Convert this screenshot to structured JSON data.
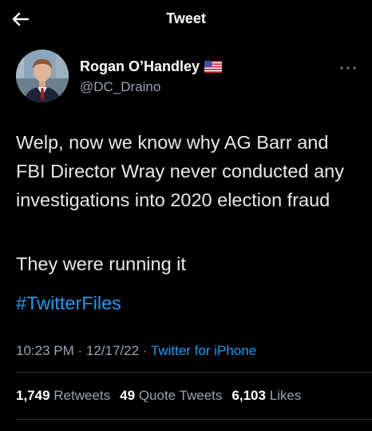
{
  "header": {
    "title": "Tweet",
    "back_icon": "arrow-left-icon"
  },
  "author": {
    "display_name": "Rogan O’Handley",
    "handle": "@DC_Draino",
    "flag_icon": "us-flag-icon",
    "more_icon": "more-horizontal-icon"
  },
  "tweet": {
    "text_line1": "Welp, now we know why AG Barr and FBI Director Wray never conducted any investigations into 2020 election fraud",
    "text_line2": "They were running it",
    "hashtag": "#TwitterFiles"
  },
  "meta": {
    "time": "10:23 PM",
    "sep1": " · ",
    "date": "12/17/22",
    "sep2": " · ",
    "source": "Twitter for iPhone"
  },
  "stats": {
    "retweets_count": "1,749",
    "retweets_label": "Retweets",
    "quotes_count": "49",
    "quotes_label": "Quote Tweets",
    "likes_count": "6,103",
    "likes_label": "Likes"
  },
  "colors": {
    "background": "#000000",
    "text": "#e7e9ea",
    "secondary": "#9aa3ad",
    "link": "#1d9bf0",
    "divider": "#2f3336"
  }
}
